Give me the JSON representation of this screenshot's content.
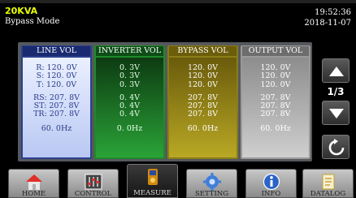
{
  "header": {
    "model": "20KVA",
    "mode": "Bypass Mode",
    "time": "19:52:36",
    "date": "2018-11-07"
  },
  "columns": {
    "line": {
      "title": "LINE VOL",
      "rows": [
        "R: 120. 0V",
        "S: 120. 0V",
        "T: 120. 0V",
        "RS: 207. 8V",
        "ST: 207. 8V",
        "TR: 207. 8V"
      ],
      "freq": "60. 0Hz"
    },
    "inverter": {
      "title": "INVERTER VOL",
      "rows": [
        "0. 3V",
        "0. 3V",
        "0. 3V",
        "0. 4V",
        "0. 4V",
        "0. 4V"
      ],
      "freq": "0. 0Hz"
    },
    "bypass": {
      "title": "BYPASS VOL",
      "rows": [
        "120. 0V",
        "120. 0V",
        "120. 0V",
        "207. 8V",
        "207. 8V",
        "207. 8V"
      ],
      "freq": "60. 0Hz"
    },
    "output": {
      "title": "OUTPUT VOL",
      "rows": [
        "120. 0V",
        "120. 0V",
        "120. 0V",
        "207. 8V",
        "207. 8V",
        "207. 8V"
      ],
      "freq": "60. 0Hz"
    }
  },
  "pager": {
    "indicator": "1/3"
  },
  "icons": {
    "up": "arrow-up-icon",
    "down": "arrow-down-icon",
    "refresh": "refresh-icon"
  },
  "nav": {
    "home": "HOME",
    "control": "CONTROL",
    "measure": "MEASURE",
    "setting": "SETTING",
    "info": "INFO",
    "datalog": "DATALOG",
    "active": "MEASURE"
  }
}
